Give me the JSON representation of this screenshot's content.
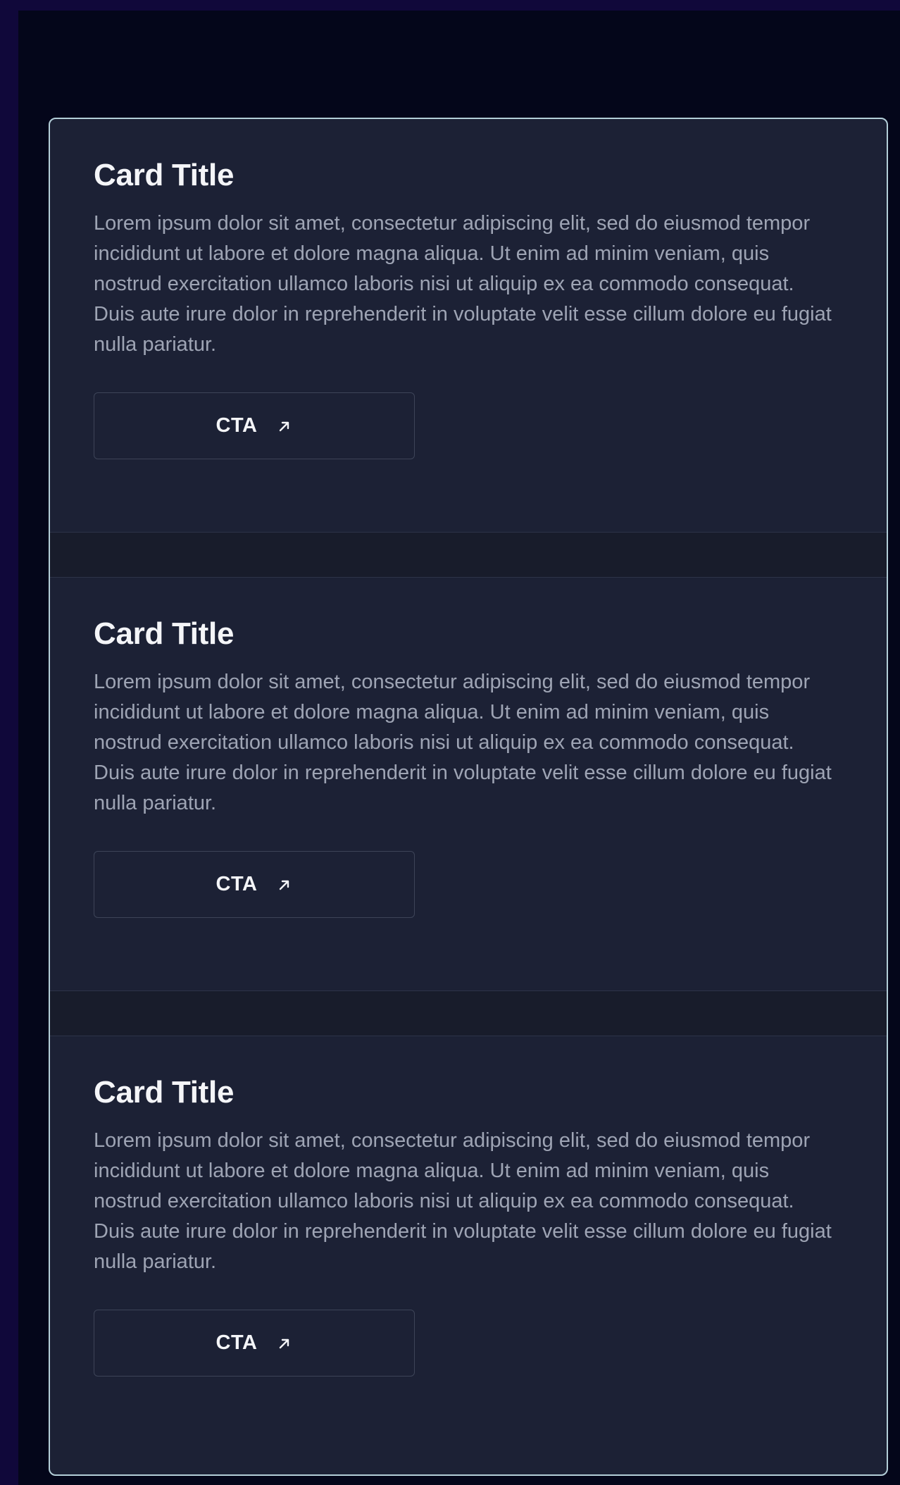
{
  "cards": [
    {
      "title": "Card Title",
      "body": "Lorem ipsum dolor sit amet, consectetur adipiscing elit, sed do eiusmod tempor incididunt ut labore et dolore magna aliqua. Ut enim ad minim veniam, quis nostrud exercitation ullamco laboris nisi ut aliquip ex ea commodo consequat. Duis aute irure dolor in reprehenderit in voluptate velit esse cillum dolore eu fugiat nulla pariatur.",
      "cta_label": "CTA",
      "cta_icon": "arrow-up-right-icon"
    },
    {
      "title": "Card Title",
      "body": "Lorem ipsum dolor sit amet, consectetur adipiscing elit, sed do eiusmod tempor incididunt ut labore et dolore magna aliqua. Ut enim ad minim veniam, quis nostrud exercitation ullamco laboris nisi ut aliquip ex ea commodo consequat. Duis aute irure dolor in reprehenderit in voluptate velit esse cillum dolore eu fugiat nulla pariatur.",
      "cta_label": "CTA",
      "cta_icon": "arrow-up-right-icon"
    },
    {
      "title": "Card Title",
      "body": "Lorem ipsum dolor sit amet, consectetur adipiscing elit, sed do eiusmod tempor incididunt ut labore et dolore magna aliqua. Ut enim ad minim veniam, quis nostrud exercitation ullamco laboris nisi ut aliquip ex ea commodo consequat. Duis aute irure dolor in reprehenderit in voluptate velit esse cillum dolore eu fugiat nulla pariatur.",
      "cta_label": "CTA",
      "cta_icon": "arrow-up-right-icon"
    }
  ],
  "colors": {
    "outer_background": "#10083a",
    "page_background": "#04061a",
    "card_background": "#1c2135",
    "card_border": "#b3ced8",
    "title_text": "#f4f5f8",
    "body_text": "#9ea4b4",
    "button_border": "#3d4458"
  }
}
